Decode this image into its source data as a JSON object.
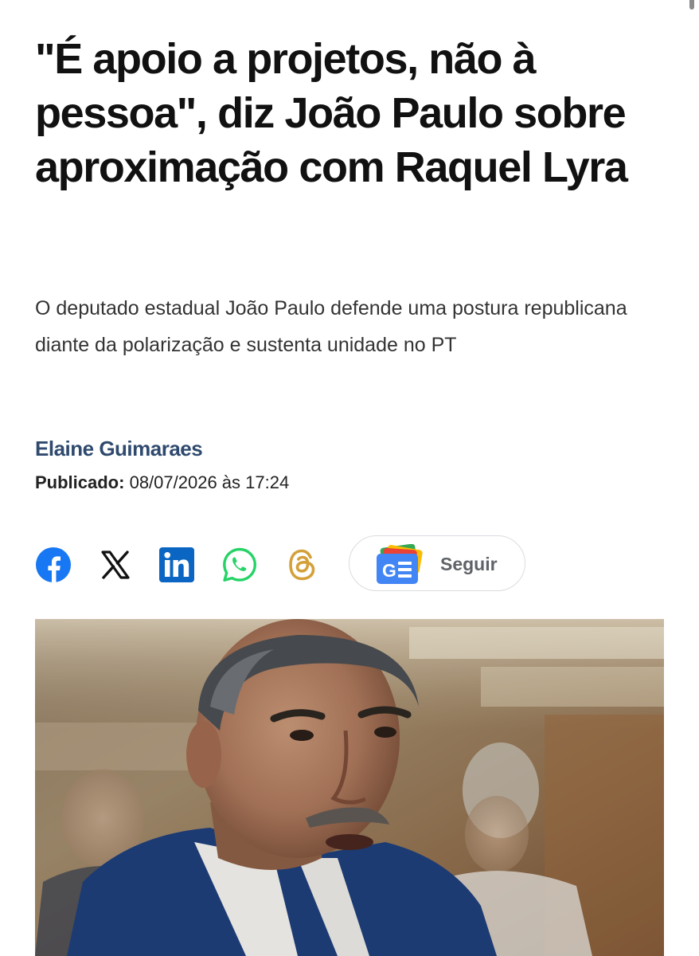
{
  "article": {
    "headline": "\"É apoio a projetos, não à pessoa\", diz João Paulo sobre aproximação com Raquel Lyra",
    "subtitle": "O deputado estadual João Paulo defende uma postura republicana diante da polarização e sustenta unidade no PT",
    "author": "Elaine Guimaraes",
    "published_label": "Publicado:",
    "published_value": "08/07/2026 às 17:24"
  },
  "share": {
    "icons": [
      "facebook-icon",
      "x-icon",
      "linkedin-icon",
      "whatsapp-icon",
      "threads-icon"
    ],
    "follow_label": "Seguir"
  },
  "colors": {
    "facebook": "#1877f2",
    "linkedin": "#0a66c2",
    "whatsapp": "#25d366",
    "threads": "#d4a03a",
    "author": "#2f4a6e"
  }
}
